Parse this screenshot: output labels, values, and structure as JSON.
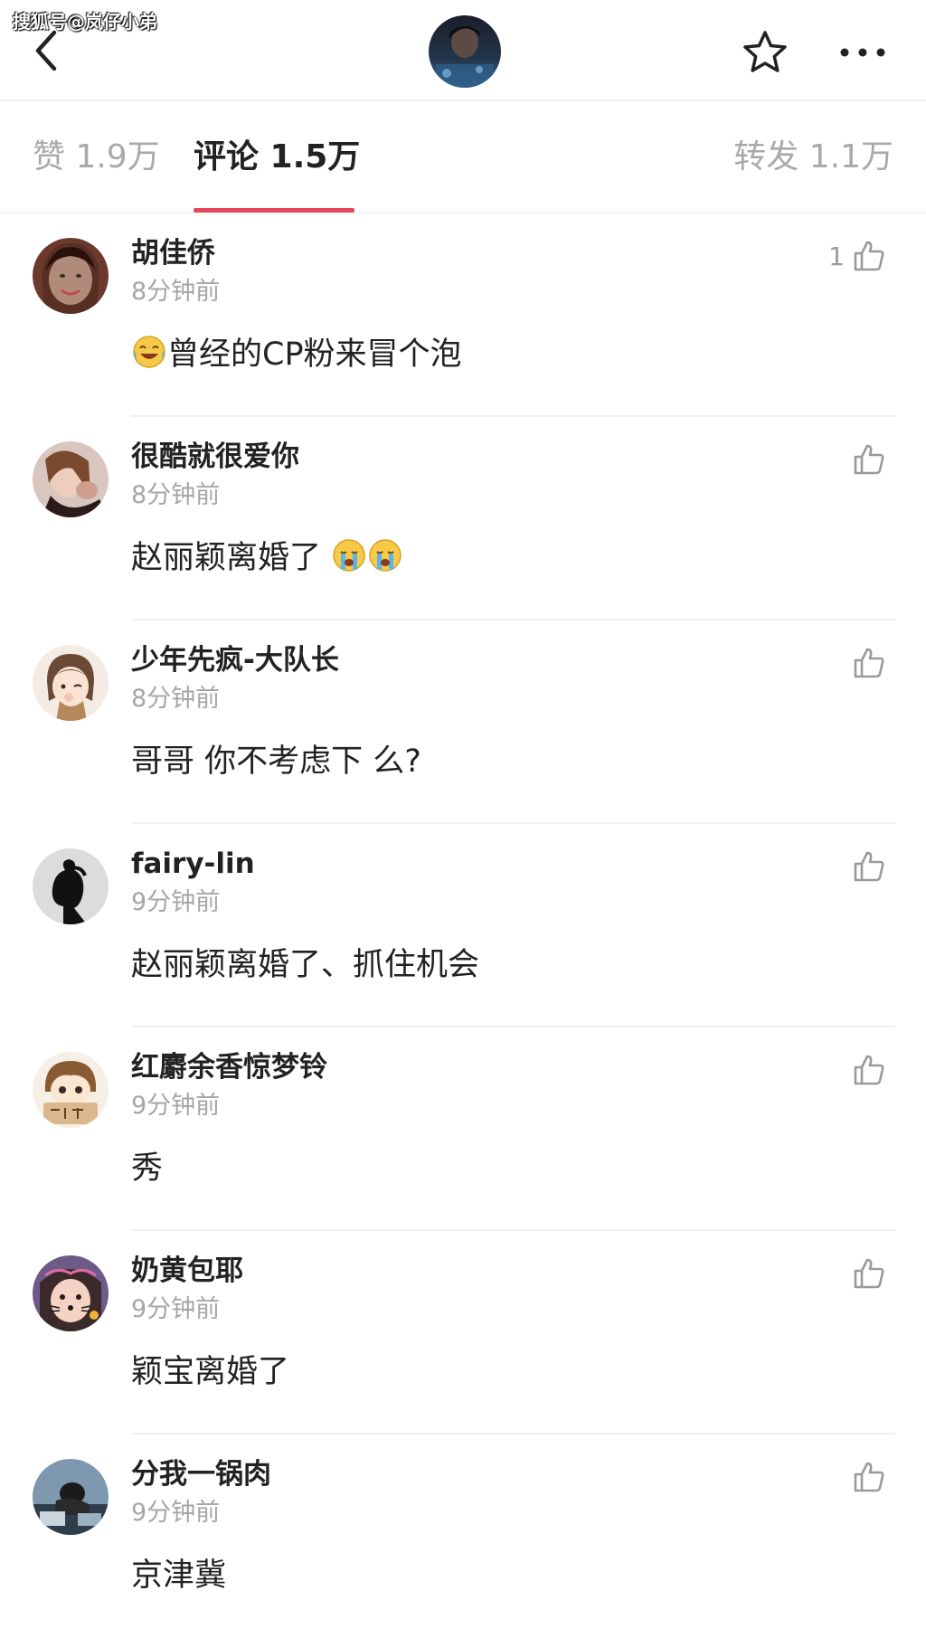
{
  "watermark": "搜狐号@岚仔小弟",
  "header": {
    "back_icon": "chevron-left-icon",
    "avatar": "profile-avatar",
    "favorite_icon": "star-icon",
    "more_icon": "more-dots-icon"
  },
  "tabs": [
    {
      "label": "赞 1.9万",
      "active": false
    },
    {
      "label": "评论 1.5万",
      "active": true
    },
    {
      "label": "转发 1.1万",
      "active": false
    }
  ],
  "colors": {
    "accent": "#e5485d",
    "muted": "#a6a6a6",
    "text": "#222222"
  },
  "comments": [
    {
      "name": "胡佳侨",
      "time": "8分钟前",
      "text": "曾经的CP粉来冒个泡",
      "emoji_before": "laughing-tears-emoji",
      "emoji_after_count": 0,
      "likes": "1"
    },
    {
      "name": "很酷就很爱你",
      "time": "8分钟前",
      "text": "赵丽颖离婚了",
      "emoji_before": "",
      "emoji_after": "crying-emoji",
      "emoji_after_count": 2,
      "likes": ""
    },
    {
      "name": "少年先疯-大队长",
      "time": "8分钟前",
      "text": "哥哥 你不考虑下  么?",
      "emoji_before": "",
      "emoji_after_count": 0,
      "likes": ""
    },
    {
      "name": "fairy-lin",
      "time": "9分钟前",
      "text": "赵丽颖离婚了、抓住机会",
      "emoji_before": "",
      "emoji_after_count": 0,
      "likes": ""
    },
    {
      "name": "红麝余香惊梦铃",
      "time": "9分钟前",
      "text": "秀",
      "emoji_before": "",
      "emoji_after_count": 0,
      "likes": ""
    },
    {
      "name": "奶黄包耶",
      "time": "9分钟前",
      "text": "颖宝离婚了",
      "emoji_before": "",
      "emoji_after_count": 0,
      "likes": ""
    },
    {
      "name": "分我一锅肉",
      "time": "9分钟前",
      "text": "京津冀",
      "emoji_before": "",
      "emoji_after_count": 0,
      "likes": ""
    }
  ]
}
